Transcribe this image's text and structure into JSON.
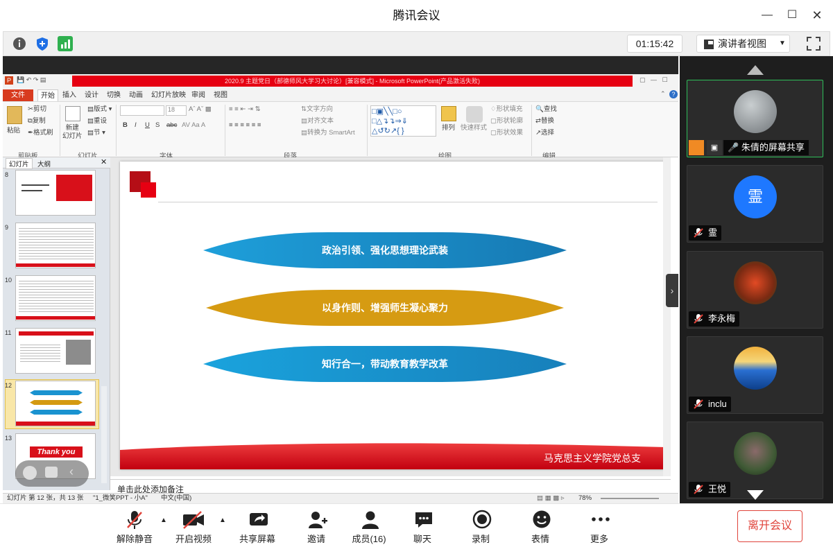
{
  "app": {
    "title": "腾讯会议"
  },
  "toolbar": {
    "timer": "01:15:42",
    "view_label": "演讲者视图"
  },
  "ppt": {
    "window_title": "2020.9 主题党日（郝德师风大学习大讨论）[兼容模式] - Microsoft PowerPoint(产品激活失败)",
    "tabs": [
      "文件",
      "开始",
      "插入",
      "设计",
      "切换",
      "动画",
      "幻灯片放映",
      "审阅",
      "视图"
    ],
    "clipboard": {
      "paste": "粘贴",
      "cut": "剪切",
      "copy": "复制",
      "format_painter": "格式刷",
      "group": "剪贴板"
    },
    "slides_group": {
      "new_slide": "新建\n幻灯片",
      "layout": "版式",
      "reset": "重设",
      "section": "节",
      "group": "幻灯片"
    },
    "font": {
      "size": "18",
      "group": "字体",
      "bold": "B",
      "italic": "I",
      "underline": "U",
      "strike": "S",
      "abc": "abc"
    },
    "paragraph": {
      "text_direction": "文字方向",
      "align_text": "对齐文本",
      "smartart": "转换为 SmartArt",
      "group": "段落"
    },
    "drawing": {
      "arrange": "排列",
      "quick_styles": "快速样式",
      "fill": "形状填充",
      "outline": "形状轮廓",
      "effects": "形状效果",
      "group": "绘图"
    },
    "editing": {
      "find": "查找",
      "replace": "替换",
      "select": "选择",
      "group": "编辑"
    },
    "pane_tabs": {
      "slides": "幻灯片",
      "outline": "大纲"
    },
    "thumbnails": [
      {
        "num": "8"
      },
      {
        "num": "9"
      },
      {
        "num": "10"
      },
      {
        "num": "11"
      },
      {
        "num": "12"
      },
      {
        "num": "13"
      }
    ],
    "thumb13_text": "Thank you",
    "slide": {
      "items": [
        "政治引领、强化思想理论武装",
        "以身作则、增强师生凝心聚力",
        "知行合一，带动教育教学改革"
      ],
      "footer": "马克思主义学院党总支"
    },
    "notes_placeholder": "单击此处添加备注",
    "status": {
      "slide_info": "幻灯片 第 12 张，共 13 张",
      "theme": "\"1_微笑PPT - 小A\"",
      "language": "中文(中国)",
      "zoom": "78%"
    }
  },
  "participants": [
    {
      "name": "朱倩的屏幕共享",
      "color": "#8a8f92"
    },
    {
      "name": "霊",
      "avatar_text": "霊",
      "color": "#1e78ff"
    },
    {
      "name": "李永梅",
      "color": "#c8361e"
    },
    {
      "name": "inclu",
      "color": "#2a6fd1"
    },
    {
      "name": "王悦",
      "color": "#3f5a35"
    }
  ],
  "bottom": {
    "unmute": "解除静音",
    "video": "开启视频",
    "share": "共享屏幕",
    "invite": "邀请",
    "members": "成员(16)",
    "chat": "聊天",
    "record": "录制",
    "reaction": "表情",
    "more": "更多",
    "leave": "离开会议"
  },
  "colors": {
    "accent_red": "#e60012",
    "blue_band": "#1a93d0",
    "gold_band": "#d49a12",
    "leave": "#e0433a"
  }
}
